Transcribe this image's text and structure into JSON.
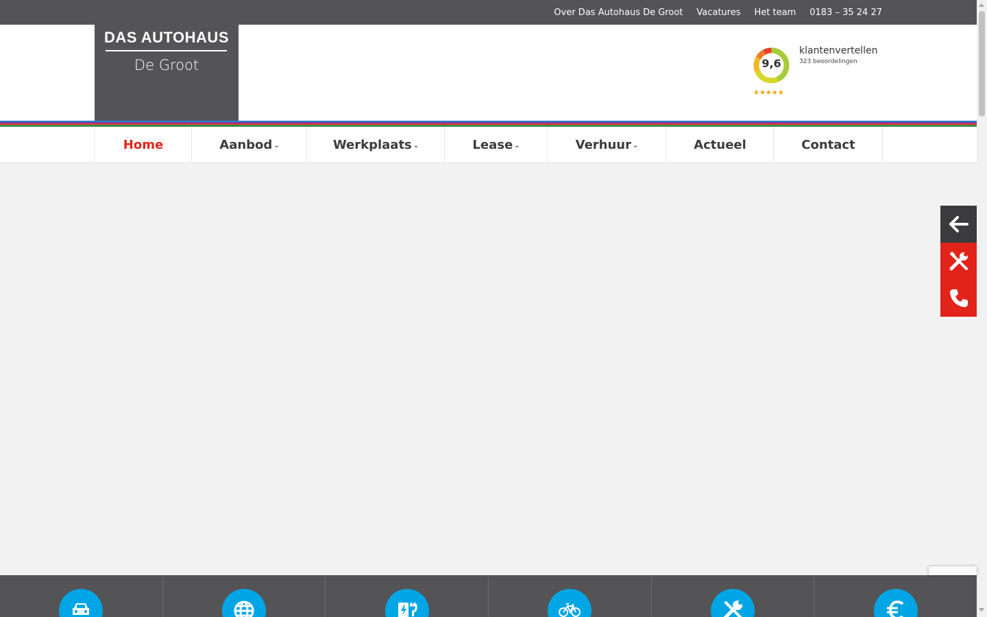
{
  "topbar": {
    "links": [
      "Over Das Autohaus De Groot",
      "Vacatures",
      "Het team",
      "0183 – 35 24 27"
    ]
  },
  "logo": {
    "line1": "DAS AUTOHAUS",
    "line2": "De Groot"
  },
  "rating": {
    "score": "9,6",
    "brand": "klantenvertellen",
    "count": "323 beoordelingen",
    "stars": "★★★★★"
  },
  "stripes": {
    "colors": [
      "#2f7fd6",
      "#7d3c98",
      "#e03a3a",
      "#3e8e41"
    ]
  },
  "nav": {
    "items": [
      {
        "label": "Home",
        "active": true,
        "dropdown": false
      },
      {
        "label": "Aanbod",
        "active": false,
        "dropdown": true
      },
      {
        "label": "Werkplaats",
        "active": false,
        "dropdown": true
      },
      {
        "label": "Lease",
        "active": false,
        "dropdown": true
      },
      {
        "label": "Verhuur",
        "active": false,
        "dropdown": true
      },
      {
        "label": "Actueel",
        "active": false,
        "dropdown": false
      },
      {
        "label": "Contact",
        "active": false,
        "dropdown": false
      }
    ],
    "caret": "⌄"
  },
  "side_buttons": [
    {
      "icon": "arrow-left-icon",
      "color": "#3b3b3d"
    },
    {
      "icon": "tools-icon",
      "color": "#e2231a"
    },
    {
      "icon": "phone-icon",
      "color": "#e2231a"
    }
  ],
  "footer_icons": [
    "car-icon",
    "globe-icon",
    "ev-charger-icon",
    "bicycle-icon",
    "tools-icon",
    "euro-icon"
  ],
  "colors": {
    "accent_red": "#e2231a",
    "dark_gray": "#545456",
    "footer_blue": "#00a5e5"
  }
}
